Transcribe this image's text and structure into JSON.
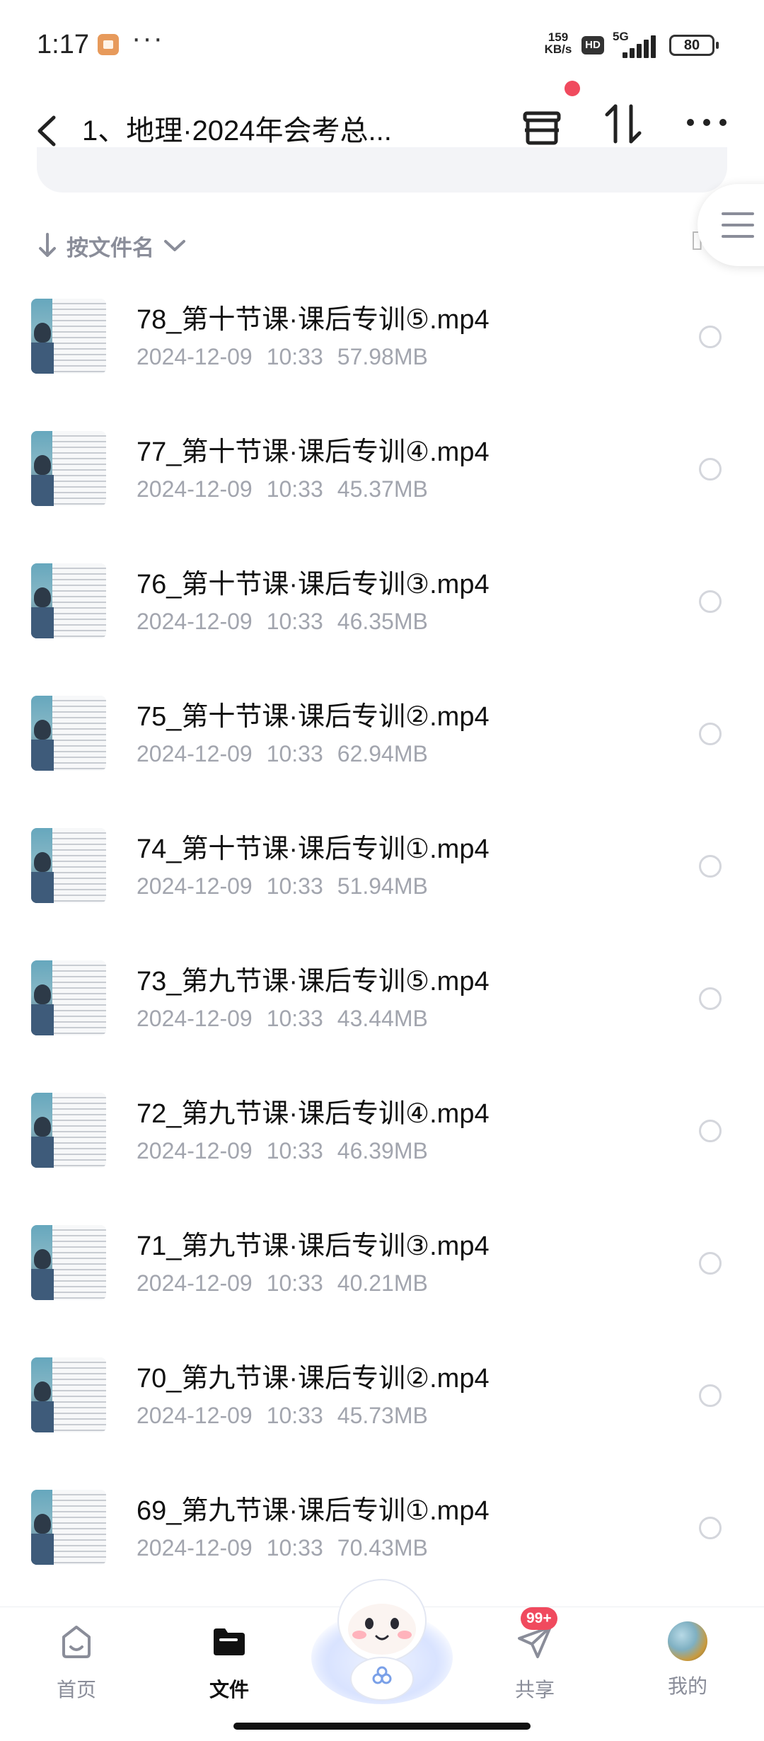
{
  "status_bar": {
    "time": "1:17",
    "more": "···",
    "speed": "159\nKB/s",
    "hd": "HD",
    "network": "5G",
    "battery": "80"
  },
  "header": {
    "title": "1、地理·2024年会考总...",
    "notification_dot_color": "#f04a5e"
  },
  "sort": {
    "label": "按文件名"
  },
  "files": [
    {
      "name": "78_第十节课·课后专训⑤.mp4",
      "date": "2024-12-09",
      "time": "10:33",
      "size": "57.98MB"
    },
    {
      "name": "77_第十节课·课后专训④.mp4",
      "date": "2024-12-09",
      "time": "10:33",
      "size": "45.37MB"
    },
    {
      "name": "76_第十节课·课后专训③.mp4",
      "date": "2024-12-09",
      "time": "10:33",
      "size": "46.35MB"
    },
    {
      "name": "75_第十节课·课后专训②.mp4",
      "date": "2024-12-09",
      "time": "10:33",
      "size": "62.94MB"
    },
    {
      "name": "74_第十节课·课后专训①.mp4",
      "date": "2024-12-09",
      "time": "10:33",
      "size": "51.94MB"
    },
    {
      "name": "73_第九节课·课后专训⑤.mp4",
      "date": "2024-12-09",
      "time": "10:33",
      "size": "43.44MB"
    },
    {
      "name": "72_第九节课·课后专训④.mp4",
      "date": "2024-12-09",
      "time": "10:33",
      "size": "46.39MB"
    },
    {
      "name": "71_第九节课·课后专训③.mp4",
      "date": "2024-12-09",
      "time": "10:33",
      "size": "40.21MB"
    },
    {
      "name": "70_第九节课·课后专训②.mp4",
      "date": "2024-12-09",
      "time": "10:33",
      "size": "45.73MB"
    },
    {
      "name": "69_第九节课·课后专训①.mp4",
      "date": "2024-12-09",
      "time": "10:33",
      "size": "70.43MB"
    }
  ],
  "bottom_nav": {
    "home": "首页",
    "files": "文件",
    "share": "共享",
    "share_badge": "99+",
    "mine": "我的"
  }
}
